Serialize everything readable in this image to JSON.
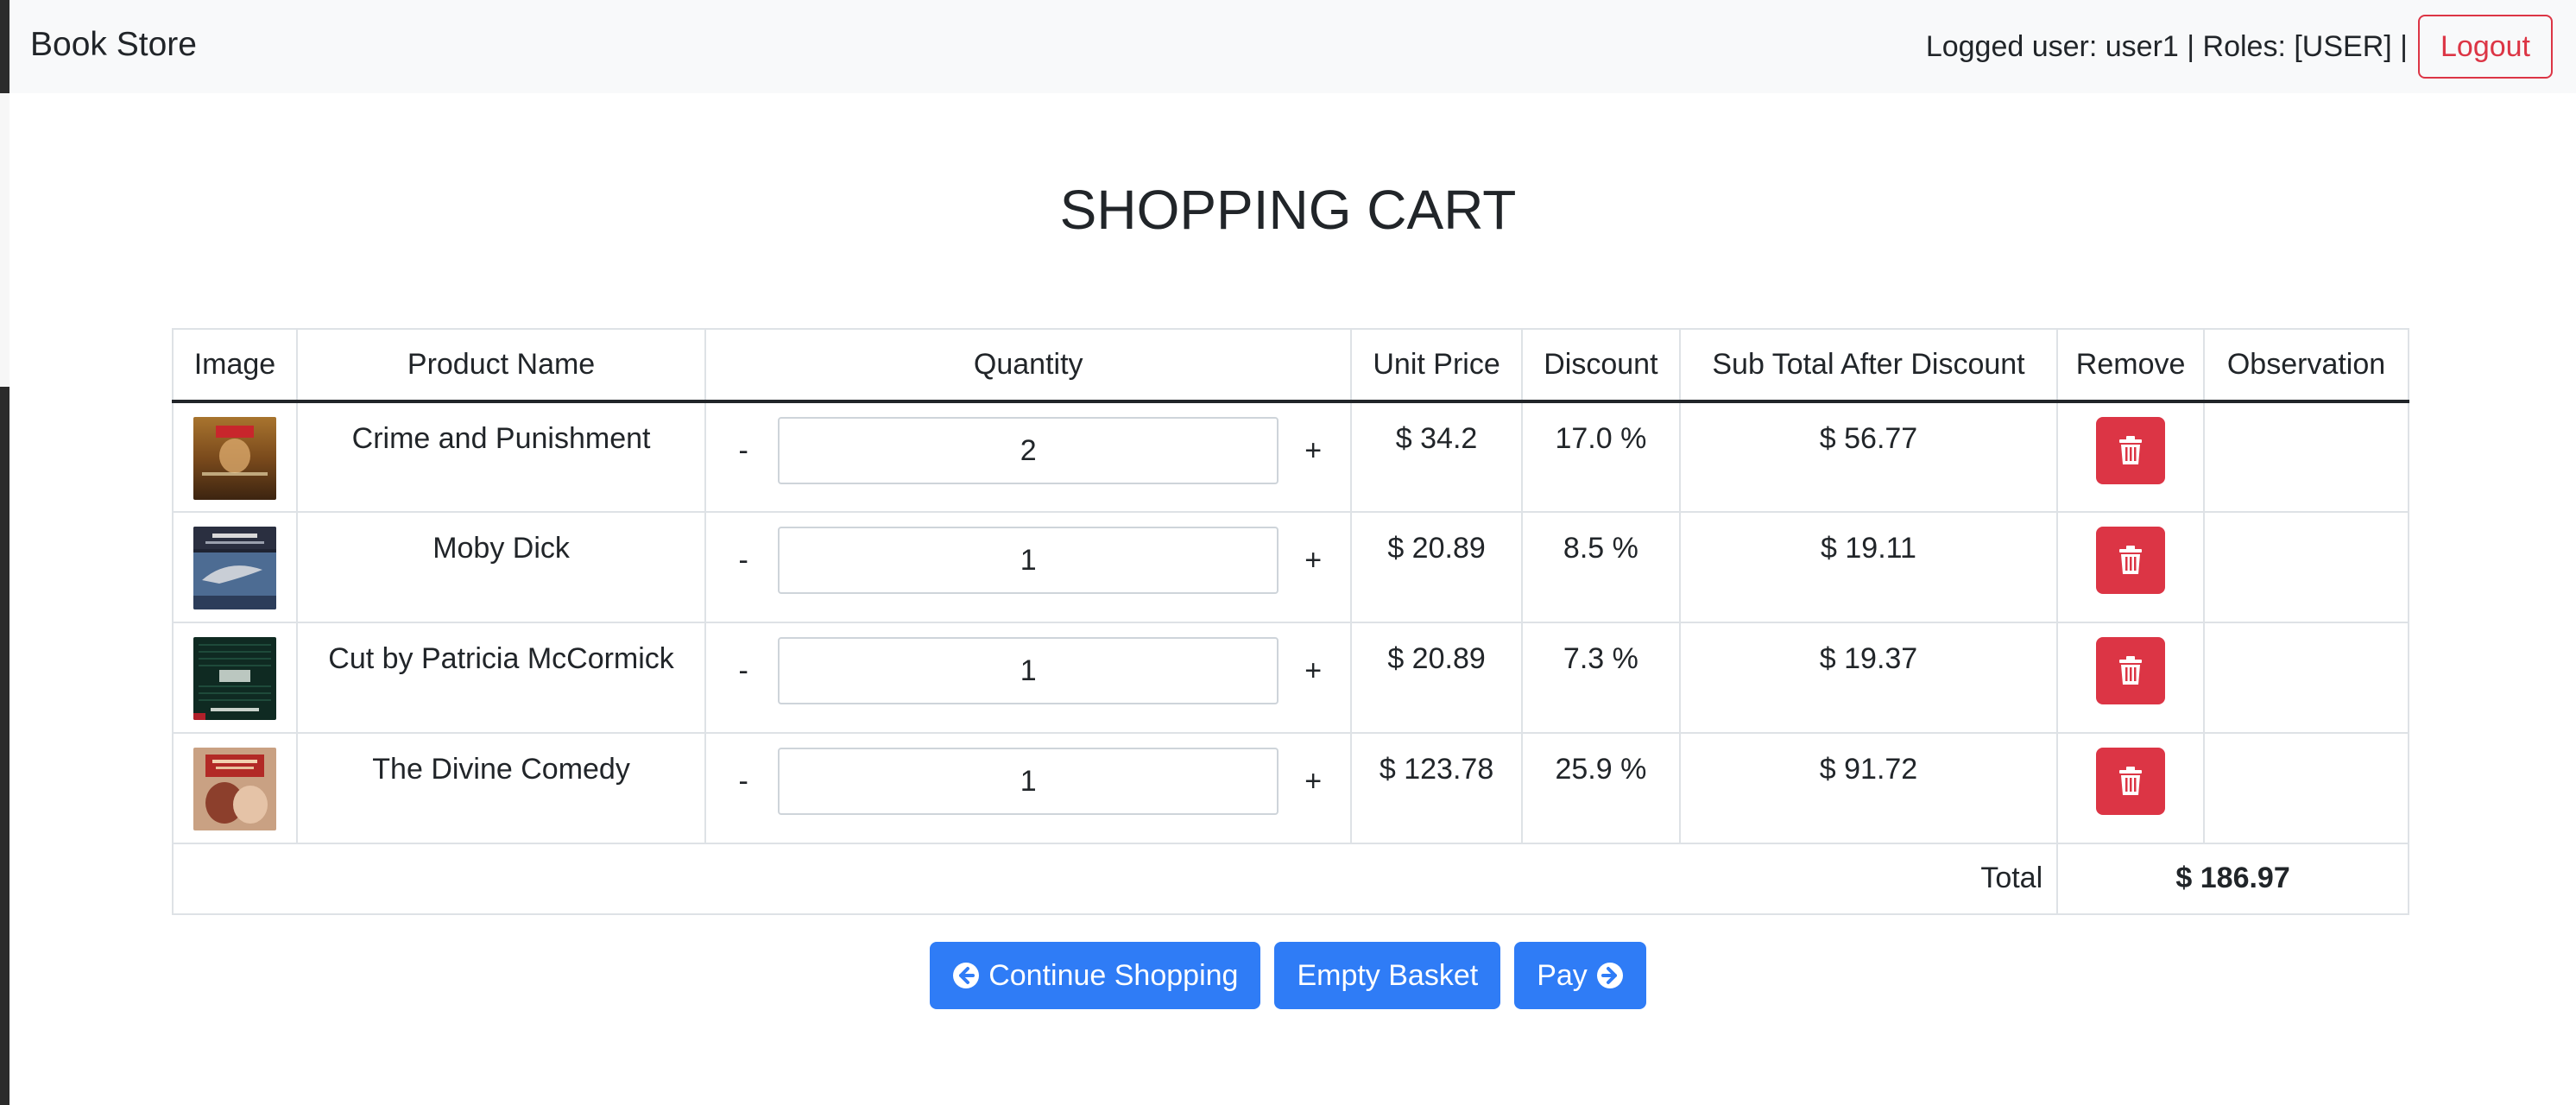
{
  "navbar": {
    "brand": "Book Store",
    "user_info": "Logged user: user1 | Roles: [USER] |",
    "logout_label": "Logout"
  },
  "page": {
    "title": "SHOPPING CART"
  },
  "table": {
    "headers": {
      "image": "Image",
      "product_name": "Product Name",
      "quantity": "Quantity",
      "unit_price": "Unit Price",
      "discount": "Discount",
      "subtotal": "Sub Total After Discount",
      "remove": "Remove",
      "observation": "Observation"
    },
    "qty_minus": "-",
    "qty_plus": "+",
    "rows": [
      {
        "name": "Crime and Punishment",
        "quantity": "2",
        "unit_price": "$ 34.2",
        "discount": "17.0 %",
        "subtotal": "$ 56.77",
        "observation": ""
      },
      {
        "name": "Moby Dick",
        "quantity": "1",
        "unit_price": "$ 20.89",
        "discount": "8.5 %",
        "subtotal": "$ 19.11",
        "observation": ""
      },
      {
        "name": "Cut by Patricia McCormick",
        "quantity": "1",
        "unit_price": "$ 20.89",
        "discount": "7.3 %",
        "subtotal": "$ 19.37",
        "observation": ""
      },
      {
        "name": "The Divine Comedy",
        "quantity": "1",
        "unit_price": "$ 123.78",
        "discount": "25.9 %",
        "subtotal": "$ 91.72",
        "observation": ""
      }
    ],
    "total_label": "Total",
    "total_value": "$ 186.97"
  },
  "actions": {
    "continue_label": "Continue Shopping",
    "empty_label": "Empty Basket",
    "pay_label": "Pay"
  },
  "colors": {
    "primary": "#2f7cf6",
    "danger": "#dc3545",
    "navbar_bg": "#f8f9fa"
  },
  "icons": {
    "remove": "trash-icon",
    "continue": "arrow-circle-left-icon",
    "pay": "arrow-circle-right-icon"
  }
}
